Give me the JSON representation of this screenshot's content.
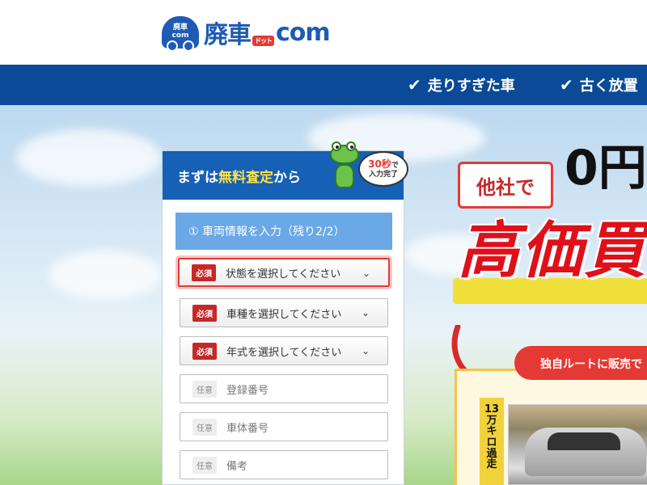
{
  "header": {
    "logo_car_line1": "廃車",
    "logo_car_line2": "com",
    "logo_main": "廃車",
    "logo_dot": "ドット",
    "logo_com": "com"
  },
  "nav": {
    "items": [
      {
        "label": "走りすぎた車"
      },
      {
        "label": "古く放置"
      }
    ]
  },
  "form": {
    "head_prefix": "まずは",
    "head_highlight": "無料査定",
    "head_suffix": "から",
    "bubble_big": "30秒",
    "bubble_de": "で",
    "bubble_line2": "入力完了",
    "step_label": "① 車両情報を入力（残り2/2）",
    "required_badge": "必須",
    "optional_badge": "任意",
    "fields": [
      {
        "label": "状態を選択してください",
        "type": "select",
        "required": true
      },
      {
        "label": "車種を選択してください",
        "type": "select",
        "required": true
      },
      {
        "label": "年式を選択してください",
        "type": "select",
        "required": true
      },
      {
        "placeholder": "登録番号",
        "type": "text",
        "required": false
      },
      {
        "placeholder": "車体番号",
        "type": "text",
        "required": false
      },
      {
        "placeholder": "備考",
        "type": "text",
        "required": false
      }
    ]
  },
  "promo": {
    "other_companies": "他社で",
    "zero": "0円",
    "big_text": "高価買",
    "route_pill": "独自ルートに販売で",
    "km_chars": [
      "13",
      "万",
      "キ",
      "ロ",
      "過",
      "走"
    ]
  },
  "colors": {
    "brand_blue": "#1d5bb5",
    "nav_blue": "#0a4a96",
    "form_head_blue": "#1660b5",
    "step_blue": "#6aa8e6",
    "required_red": "#c62828",
    "accent_red": "#e53935",
    "highlight_yellow": "#ffe14a"
  }
}
